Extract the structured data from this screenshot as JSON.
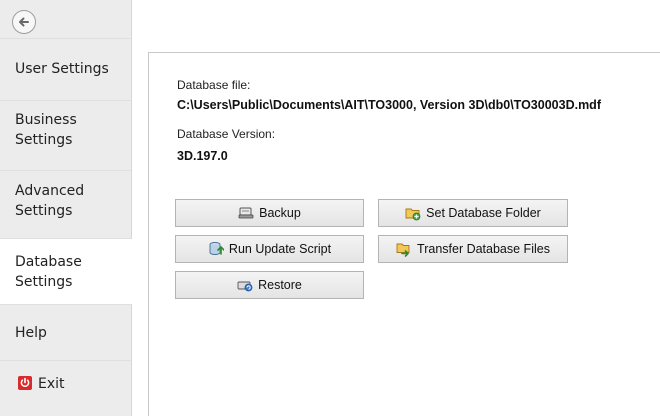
{
  "sidebar": {
    "items": [
      {
        "label": "User Settings"
      },
      {
        "label": "Business Settings",
        "line1": "Business",
        "line2": "Settings"
      },
      {
        "label": "Advanced Settings",
        "line1": "Advanced",
        "line2": "Settings"
      },
      {
        "label": "Database Settings",
        "line1": "Database",
        "line2": "Settings",
        "active": true
      },
      {
        "label": "Help"
      },
      {
        "label": "Exit"
      }
    ]
  },
  "database": {
    "file_label": "Database file:",
    "file_path": "C:\\Users\\Public\\Documents\\AIT\\TO3000, Version 3D\\db0\\TO30003D.mdf",
    "version_label": "Database Version:",
    "version_value": "3D.197.0"
  },
  "buttons": {
    "backup": "Backup",
    "run_update_script": "Run Update Script",
    "restore": "Restore",
    "set_database_folder": "Set Database Folder",
    "transfer_database_files": "Transfer Database Files"
  },
  "icons": {
    "back": "back-arrow-icon",
    "exit": "power-icon",
    "backup": "scanner-icon",
    "run_update_script": "database-update-icon",
    "restore": "restore-icon",
    "set_database_folder": "folder-add-icon",
    "transfer_database_files": "folder-transfer-icon"
  },
  "colors": {
    "sidebar_bg": "#ececec",
    "active_bg": "#ffffff",
    "exit_red": "#d92b2b"
  }
}
